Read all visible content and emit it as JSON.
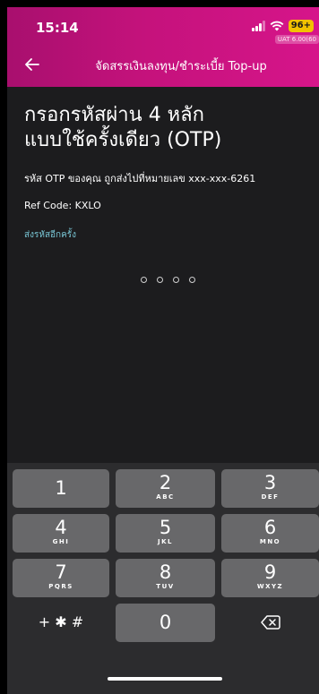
{
  "status_bar": {
    "time": "15:14",
    "battery": "96+",
    "env_tag": "UAT 6.00(60"
  },
  "header": {
    "title": "จัดสรรเงินลงทุน/ชำระเบี้ย Top-up"
  },
  "otp": {
    "title_line1": "กรอกรหัสผ่าน 4 หลัก",
    "title_line2": "แบบใช้ครั้งเดียว (OTP)",
    "description": "รหัส OTP ของคุณ ถูกส่งไปที่หมายเลข xxx-xxx-6261",
    "ref_code": "Ref Code: KXLO",
    "resend_label": "ส่งรหัสอีกครั้ง",
    "digits_entered": 0,
    "digits_total": 4
  },
  "keypad": {
    "keys": [
      {
        "num": "1",
        "letters": ""
      },
      {
        "num": "2",
        "letters": "ABC"
      },
      {
        "num": "3",
        "letters": "DEF"
      },
      {
        "num": "4",
        "letters": "GHI"
      },
      {
        "num": "5",
        "letters": "JKL"
      },
      {
        "num": "6",
        "letters": "MNO"
      },
      {
        "num": "7",
        "letters": "PQRS"
      },
      {
        "num": "8",
        "letters": "TUV"
      },
      {
        "num": "9",
        "letters": "WXYZ"
      },
      {
        "num": "0",
        "letters": ""
      }
    ],
    "symbols_label": "+ ✱ #"
  },
  "icons": {
    "back": "arrow-left-icon",
    "delete": "backspace-icon",
    "signal": "signal-icon",
    "wifi": "wifi-icon"
  },
  "colors": {
    "header_start": "#a80f6e",
    "header_end": "#d6158a",
    "link": "#78c4d3",
    "battery": "#f2c200"
  }
}
